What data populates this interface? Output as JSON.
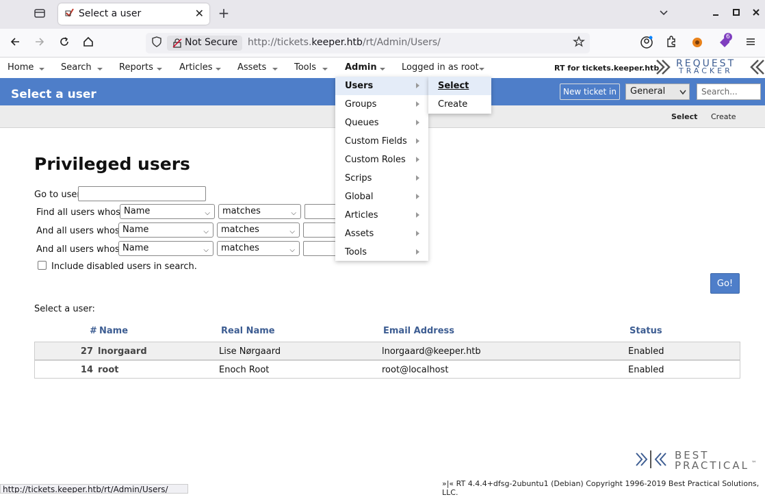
{
  "browser": {
    "tab_title": "Select a user",
    "tab_close": "✕",
    "new_tab": "+",
    "not_secure": "Not Secure",
    "url_pre": "http://tickets.",
    "url_host": "keeper.htb",
    "url_post": "/rt/Admin/Users/",
    "status_url": "http://tickets.keeper.htb/rt/Admin/Users/",
    "ext_badge": "6"
  },
  "nav": {
    "items": [
      "Home",
      "Search",
      "Reports",
      "Articles",
      "Assets",
      "Tools",
      "Admin",
      "Logged in as root"
    ],
    "site_label": "RT for tickets.keeper.htb",
    "logo_text_top": "REQUEST",
    "logo_text_bottom": "TRACKER"
  },
  "header": {
    "title": "Select a user",
    "new_ticket": "New ticket in",
    "queue_value": "General",
    "search_placeholder": "Search..."
  },
  "subnav": {
    "select": "Select",
    "create": "Create"
  },
  "admin_menu": {
    "items": [
      "Users",
      "Groups",
      "Queues",
      "Custom Fields",
      "Custom Roles",
      "Scrips",
      "Global",
      "Articles",
      "Assets",
      "Tools"
    ],
    "users_submenu": [
      "Select",
      "Create"
    ]
  },
  "main": {
    "title": "Privileged users",
    "go_to_user": "Go to user",
    "find_label": "Find all users whose",
    "and_label": "And all users whose",
    "field_value": "Name",
    "op_value": "matches",
    "include_disabled": "Include disabled users in search.",
    "go_button": "Go!",
    "select_a_user": "Select a user:"
  },
  "table": {
    "headers": [
      "#",
      "Name",
      "Real Name",
      "Email Address",
      "Status"
    ],
    "rows": [
      {
        "id": "27",
        "name": "lnorgaard",
        "real_name": "Lise Nørgaard",
        "email": "lnorgaard@keeper.htb",
        "status": "Enabled"
      },
      {
        "id": "14",
        "name": "root",
        "real_name": "Enoch Root",
        "email": "root@localhost",
        "status": "Enabled"
      }
    ]
  },
  "footer": {
    "text": "»|« RT 4.4.4+dfsg-2ubuntu1 (Debian) Copyright 1996-2019 Best Practical Solutions, LLC.",
    "logo_top": "BEST",
    "logo_bottom": "PRACTICAL",
    "logo_tm": "™"
  }
}
